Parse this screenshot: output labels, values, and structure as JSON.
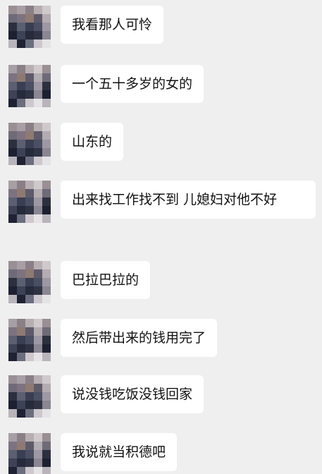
{
  "messages": [
    {
      "text": "我看那人可怜"
    },
    {
      "text": "一个五十多岁的女的"
    },
    {
      "text": "山东的"
    },
    {
      "text": "出来找工作找不到 儿媳妇对他不好"
    },
    {
      "text": "巴拉巴拉的"
    },
    {
      "text": "然后带出来的钱用完了"
    },
    {
      "text": "说没钱吃饭没钱回家"
    },
    {
      "text": "我说就当积德吧"
    }
  ],
  "colors": {
    "background": "#efefef",
    "bubble": "#ffffff",
    "text": "#111111"
  }
}
